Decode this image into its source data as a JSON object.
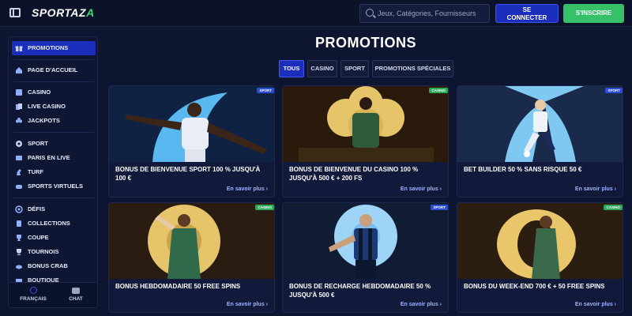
{
  "header": {
    "logo": {
      "main": "SPORTAZ",
      "accent": "A"
    },
    "search_placeholder": "Jeux, Catégories, Fournisseurs",
    "login_line1": "SE",
    "login_line2": "CONNECTER",
    "signup": "S'INSCRIRE"
  },
  "sidebar": {
    "items": [
      {
        "label": "PROMOTIONS",
        "icon": "gift-icon"
      },
      {
        "label": "PAGE D'ACCUEIL",
        "icon": "home-icon"
      },
      {
        "label": "CASINO",
        "icon": "slot-icon"
      },
      {
        "label": "LIVE CASINO",
        "icon": "cards-icon"
      },
      {
        "label": "JACKPOTS",
        "icon": "clover-icon"
      },
      {
        "label": "SPORT",
        "icon": "ball-icon"
      },
      {
        "label": "PARIS EN LIVE",
        "icon": "live-icon"
      },
      {
        "label": "TURF",
        "icon": "horse-icon"
      },
      {
        "label": "SPORTS VIRTUELS",
        "icon": "controller-icon"
      },
      {
        "label": "DÉFIS",
        "icon": "target-icon"
      },
      {
        "label": "COLLECTIONS",
        "icon": "collection-icon"
      },
      {
        "label": "COUPE",
        "icon": "cup-icon"
      },
      {
        "label": "TOURNOIS",
        "icon": "trophy-icon"
      },
      {
        "label": "BONUS CRAB",
        "icon": "crab-icon"
      },
      {
        "label": "BOUTIQUE",
        "icon": "shop-icon"
      }
    ],
    "language": "FRANÇAIS",
    "chat": "CHAT"
  },
  "main": {
    "title": "PROMOTIONS",
    "tabs": [
      "TOUS",
      "CASINO",
      "SPORT",
      "PROMOTIONS SPÉCIALES"
    ],
    "cards": [
      {
        "badge": "SPORT",
        "title": "BONUS DE BIENVENUE SPORT 100 % JUSQU'À 100 €",
        "more": "En savoir plus"
      },
      {
        "badge": "CASINO",
        "title": "BONUS DE BIENVENUE DU CASINO 100 % JUSQU'À 500 € + 200 FS",
        "more": "En savoir plus"
      },
      {
        "badge": "SPORT",
        "title": "BET BUILDER 50 % SANS RISQUE 50 €",
        "more": "En savoir plus"
      },
      {
        "badge": "CASINO",
        "title": "BONUS HEBDOMADAIRE 50 FREE SPINS",
        "more": "En savoir plus"
      },
      {
        "badge": "SPORT",
        "title": "BONUS DE RECHARGE HEBDOMADAIRE 50 % JUSQU'À 500 €",
        "more": "En savoir plus"
      },
      {
        "badge": "CASINO",
        "title": "BONUS DU WEEK-END 700 € + 50 FREE SPINS",
        "more": "En savoir plus"
      }
    ]
  },
  "colors": {
    "background": "#0d1530",
    "accent_blue": "#1a2dbb",
    "accent_green": "#37c06a",
    "link": "#9eb2ff"
  }
}
